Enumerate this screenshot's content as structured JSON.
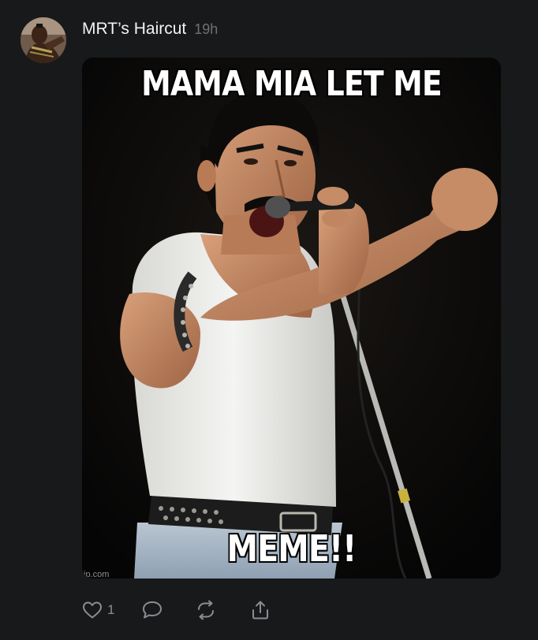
{
  "post": {
    "author": "MRT’s Haircut",
    "time": "19h",
    "image": {
      "top_caption": "MAMA MIA LET ME",
      "bottom_caption": "MEME!!",
      "watermark": "ip.com"
    },
    "actions": {
      "like_icon": "heart-icon",
      "like_count": "1",
      "reply_icon": "comment-icon",
      "repost_icon": "repost-icon",
      "share_icon": "share-icon"
    }
  },
  "colors": {
    "background": "#18191b",
    "author_text": "#f2f3f5",
    "muted_text": "#6e7176",
    "icon": "#8a8d92"
  }
}
